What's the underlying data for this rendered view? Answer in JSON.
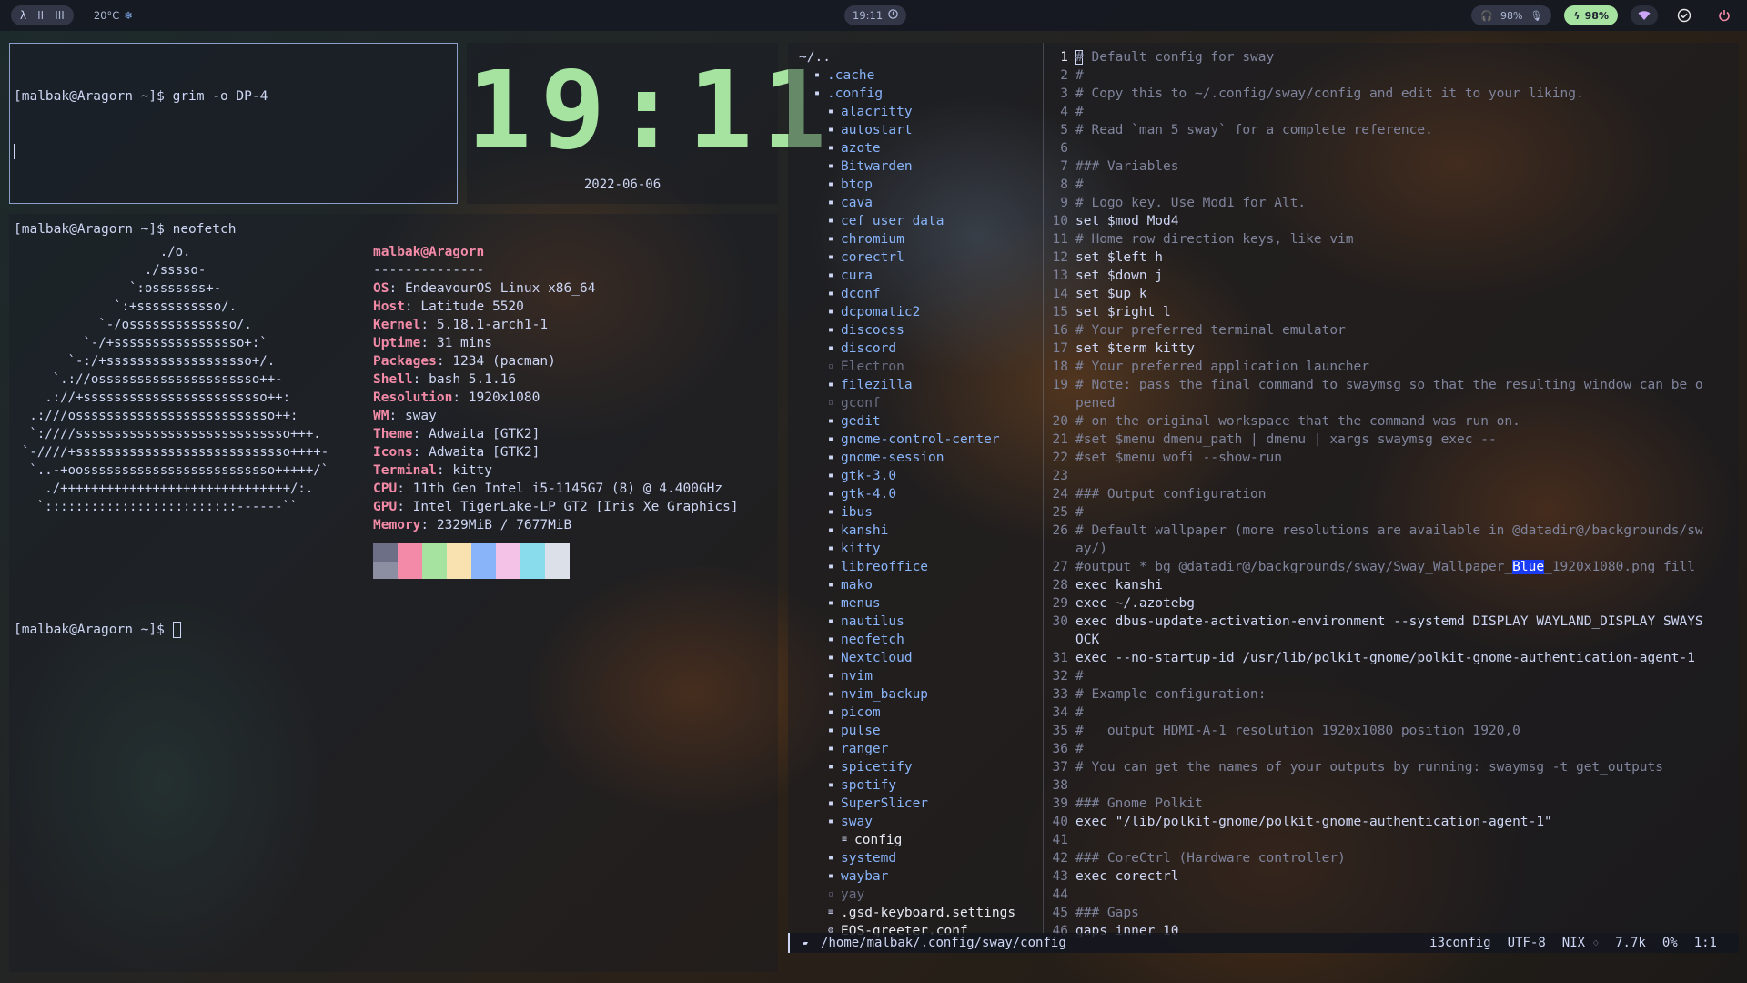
{
  "topbar": {
    "workspaces": [
      "λ",
      "II",
      "III"
    ],
    "temperature": "20°C",
    "clock": "19:11",
    "headphone_level": "98%",
    "battery_level": "98%"
  },
  "term1": {
    "prompt_line": "[malbak@Aragorn ~]$ grim -o DP-4"
  },
  "clock_widget": {
    "time": "19:11",
    "date": "2022-06-06"
  },
  "term2": {
    "prompt_line": "[malbak@Aragorn ~]$ neofetch",
    "final_prompt": "[malbak@Aragorn ~]$ ",
    "logo": [
      "                  ./o.",
      "                ./sssso-",
      "              `:osssssss+-",
      "            `:+sssssssssso/.",
      "          `-/ossssssssssssso/.",
      "        `-/+sssssssssssssssso+:`",
      "      `-:/+sssssssssssssssssso+/.",
      "    `.://osssssssssssssssssssso++-",
      "   .://+ssssssssssssssssssssssso++:",
      " .:///ossssssssssssssssssssssssso++:",
      " `:////ssssssssssssssssssssssssssso+++.",
      "`-////+ssssssssssssssssssssssssssso++++-",
      " `..-+oosssssssssssssssssssssssso+++++/`",
      "   ./++++++++++++++++++++++++++++++/:.",
      "  `:::::::::::::::::::::::::------``"
    ],
    "user_host": "malbak@Aragorn",
    "separator": "--------------",
    "info": [
      {
        "key": "OS",
        "value": "EndeavourOS Linux x86_64"
      },
      {
        "key": "Host",
        "value": "Latitude 5520"
      },
      {
        "key": "Kernel",
        "value": "5.18.1-arch1-1"
      },
      {
        "key": "Uptime",
        "value": "31 mins"
      },
      {
        "key": "Packages",
        "value": "1234 (pacman)"
      },
      {
        "key": "Shell",
        "value": "bash 5.1.16"
      },
      {
        "key": "Resolution",
        "value": "1920x1080"
      },
      {
        "key": "WM",
        "value": "sway"
      },
      {
        "key": "Theme",
        "value": "Adwaita [GTK2]"
      },
      {
        "key": "Icons",
        "value": "Adwaita [GTK2]"
      },
      {
        "key": "Terminal",
        "value": "kitty"
      },
      {
        "key": "CPU",
        "value": "11th Gen Intel i5-1145G7 (8) @ 4.400GHz"
      },
      {
        "key": "GPU",
        "value": "Intel TigerLake-LP GT2 [Iris Xe Graphics]"
      },
      {
        "key": "Memory",
        "value": "2329MiB / 7677MiB"
      }
    ],
    "palette": [
      [
        "#6c6f85",
        "#8c8fa1"
      ],
      [
        "#f38ba8",
        "#f38ba8"
      ],
      [
        "#a6e3a1",
        "#a6e3a1"
      ],
      [
        "#f9e2af",
        "#f9e2af"
      ],
      [
        "#89b4fa",
        "#89b4fa"
      ],
      [
        "#f5c2e7",
        "#f5c2e7"
      ],
      [
        "#89dceb",
        "#89dceb"
      ],
      [
        "#dce0e8",
        "#dce0e8"
      ]
    ]
  },
  "tree": {
    "root": "~/..",
    "items": [
      {
        "name": ".cache",
        "indent": 1,
        "type": "dir"
      },
      {
        "name": ".config",
        "indent": 1,
        "type": "dir"
      },
      {
        "name": "alacritty",
        "indent": 2,
        "type": "dir"
      },
      {
        "name": "autostart",
        "indent": 2,
        "type": "dir"
      },
      {
        "name": "azote",
        "indent": 2,
        "type": "dir"
      },
      {
        "name": "Bitwarden",
        "indent": 2,
        "type": "dir"
      },
      {
        "name": "btop",
        "indent": 2,
        "type": "dir"
      },
      {
        "name": "cava",
        "indent": 2,
        "type": "dir"
      },
      {
        "name": "cef_user_data",
        "indent": 2,
        "type": "dir"
      },
      {
        "name": "chromium",
        "indent": 2,
        "type": "dir"
      },
      {
        "name": "corectrl",
        "indent": 2,
        "type": "dir"
      },
      {
        "name": "cura",
        "indent": 2,
        "type": "dir"
      },
      {
        "name": "dconf",
        "indent": 2,
        "type": "dir"
      },
      {
        "name": "dcpomatic2",
        "indent": 2,
        "type": "dir"
      },
      {
        "name": "discocss",
        "indent": 2,
        "type": "dir"
      },
      {
        "name": "discord",
        "indent": 2,
        "type": "dir"
      },
      {
        "name": "Electron",
        "indent": 2,
        "type": "dir",
        "dim": true
      },
      {
        "name": "filezilla",
        "indent": 2,
        "type": "dir"
      },
      {
        "name": "gconf",
        "indent": 2,
        "type": "dir",
        "dim": true
      },
      {
        "name": "gedit",
        "indent": 2,
        "type": "dir"
      },
      {
        "name": "gnome-control-center",
        "indent": 2,
        "type": "dir"
      },
      {
        "name": "gnome-session",
        "indent": 2,
        "type": "dir"
      },
      {
        "name": "gtk-3.0",
        "indent": 2,
        "type": "dir"
      },
      {
        "name": "gtk-4.0",
        "indent": 2,
        "type": "dir"
      },
      {
        "name": "ibus",
        "indent": 2,
        "type": "dir"
      },
      {
        "name": "kanshi",
        "indent": 2,
        "type": "dir"
      },
      {
        "name": "kitty",
        "indent": 2,
        "type": "dir"
      },
      {
        "name": "libreoffice",
        "indent": 2,
        "type": "dir"
      },
      {
        "name": "mako",
        "indent": 2,
        "type": "dir"
      },
      {
        "name": "menus",
        "indent": 2,
        "type": "dir"
      },
      {
        "name": "nautilus",
        "indent": 2,
        "type": "dir"
      },
      {
        "name": "neofetch",
        "indent": 2,
        "type": "dir"
      },
      {
        "name": "Nextcloud",
        "indent": 2,
        "type": "dir"
      },
      {
        "name": "nvim",
        "indent": 2,
        "type": "dir"
      },
      {
        "name": "nvim_backup",
        "indent": 2,
        "type": "dir"
      },
      {
        "name": "picom",
        "indent": 2,
        "type": "dir"
      },
      {
        "name": "pulse",
        "indent": 2,
        "type": "dir"
      },
      {
        "name": "ranger",
        "indent": 2,
        "type": "dir"
      },
      {
        "name": "spicetify",
        "indent": 2,
        "type": "dir"
      },
      {
        "name": "spotify",
        "indent": 2,
        "type": "dir"
      },
      {
        "name": "SuperSlicer",
        "indent": 2,
        "type": "dir"
      },
      {
        "name": "sway",
        "indent": 2,
        "type": "dir"
      },
      {
        "name": "config",
        "indent": 3,
        "type": "file"
      },
      {
        "name": "systemd",
        "indent": 2,
        "type": "dir"
      },
      {
        "name": "waybar",
        "indent": 2,
        "type": "dir"
      },
      {
        "name": "yay",
        "indent": 2,
        "type": "dir",
        "dim": true
      },
      {
        "name": ".gsd-keyboard.settings",
        "indent": 2,
        "type": "file"
      },
      {
        "name": "EOS-greeter.conf",
        "indent": 2,
        "type": "file2"
      }
    ]
  },
  "editor": {
    "lines": [
      {
        "n": "1",
        "t": "# Default config for sway",
        "c": true,
        "cur": true
      },
      {
        "n": "2",
        "t": "#",
        "c": true
      },
      {
        "n": "3",
        "t": "# Copy this to ~/.config/sway/config and edit it to your liking.",
        "c": true
      },
      {
        "n": "4",
        "t": "#",
        "c": true
      },
      {
        "n": "5",
        "t": "# Read `man 5 sway` for a complete reference.",
        "c": true
      },
      {
        "n": "6",
        "t": "",
        "c": false
      },
      {
        "n": "7",
        "t": "### Variables",
        "c": true
      },
      {
        "n": "8",
        "t": "#",
        "c": true
      },
      {
        "n": "9",
        "t": "# Logo key. Use Mod1 for Alt.",
        "c": true
      },
      {
        "n": "10",
        "t": "set $mod Mod4",
        "c": false
      },
      {
        "n": "11",
        "t": "# Home row direction keys, like vim",
        "c": true
      },
      {
        "n": "12",
        "t": "set $left h",
        "c": false
      },
      {
        "n": "13",
        "t": "set $down j",
        "c": false
      },
      {
        "n": "14",
        "t": "set $up k",
        "c": false
      },
      {
        "n": "15",
        "t": "set $right l",
        "c": false
      },
      {
        "n": "16",
        "t": "# Your preferred terminal emulator",
        "c": true
      },
      {
        "n": "17",
        "t": "set $term kitty",
        "c": false
      },
      {
        "n": "18",
        "t": "# Your preferred application launcher",
        "c": true
      },
      {
        "n": "19",
        "t": "# Note: pass the final command to swaymsg so that the resulting window can be o",
        "c": true
      },
      {
        "n": "",
        "t": "pened",
        "c": true
      },
      {
        "n": "20",
        "t": "# on the original workspace that the command was run on.",
        "c": true
      },
      {
        "n": "21",
        "t": "#set $menu dmenu_path | dmenu | xargs swaymsg exec --",
        "c": true
      },
      {
        "n": "22",
        "t": "#set $menu wofi --show-run",
        "c": true
      },
      {
        "n": "23",
        "t": "",
        "c": false
      },
      {
        "n": "24",
        "t": "### Output configuration",
        "c": true
      },
      {
        "n": "25",
        "t": "#",
        "c": true
      },
      {
        "n": "26",
        "t": "# Default wallpaper (more resolutions are available in @datadir@/backgrounds/sw",
        "c": true
      },
      {
        "n": "",
        "t": "ay/)",
        "c": true
      },
      {
        "n": "27",
        "t": "#output * bg @datadir@/backgrounds/sway/Sway_Wallpaper_",
        "c": true,
        "hl": "Blue",
        "after": "_1920x1080.png fill"
      },
      {
        "n": "28",
        "t": "exec kanshi",
        "c": false
      },
      {
        "n": "29",
        "t": "exec ~/.azotebg",
        "c": false
      },
      {
        "n": "30",
        "t": "exec dbus-update-activation-environment --systemd DISPLAY WAYLAND_DISPLAY SWAYS",
        "c": false
      },
      {
        "n": "",
        "t": "OCK",
        "c": false
      },
      {
        "n": "31",
        "t": "exec --no-startup-id /usr/lib/polkit-gnome/polkit-gnome-authentication-agent-1",
        "c": false
      },
      {
        "n": "32",
        "t": "#",
        "c": true
      },
      {
        "n": "33",
        "t": "# Example configuration:",
        "c": true
      },
      {
        "n": "34",
        "t": "#",
        "c": true
      },
      {
        "n": "35",
        "t": "#   output HDMI-A-1 resolution 1920x1080 position 1920,0",
        "c": true
      },
      {
        "n": "36",
        "t": "#",
        "c": true
      },
      {
        "n": "37",
        "t": "# You can get the names of your outputs by running: swaymsg -t get_outputs",
        "c": true
      },
      {
        "n": "38",
        "t": "",
        "c": false
      },
      {
        "n": "39",
        "t": "### Gnome Polkit",
        "c": true
      },
      {
        "n": "40",
        "t": "exec \"/lib/polkit-gnome/polkit-gnome-authentication-agent-1\"",
        "c": false
      },
      {
        "n": "41",
        "t": "",
        "c": false
      },
      {
        "n": "42",
        "t": "### CoreCtrl (Hardware controller)",
        "c": true
      },
      {
        "n": "43",
        "t": "exec corectrl",
        "c": false
      },
      {
        "n": "44",
        "t": "",
        "c": false
      },
      {
        "n": "45",
        "t": "### Gaps",
        "c": true
      },
      {
        "n": "46",
        "t": "gaps inner 10",
        "c": false
      }
    ]
  },
  "statusline": {
    "path": "/home/malbak/.config/sway/config",
    "filetype": "i3config",
    "encoding": "UTF-8",
    "format": "NIX",
    "size": "7.7k",
    "percent": "0%",
    "position": "1:1"
  }
}
